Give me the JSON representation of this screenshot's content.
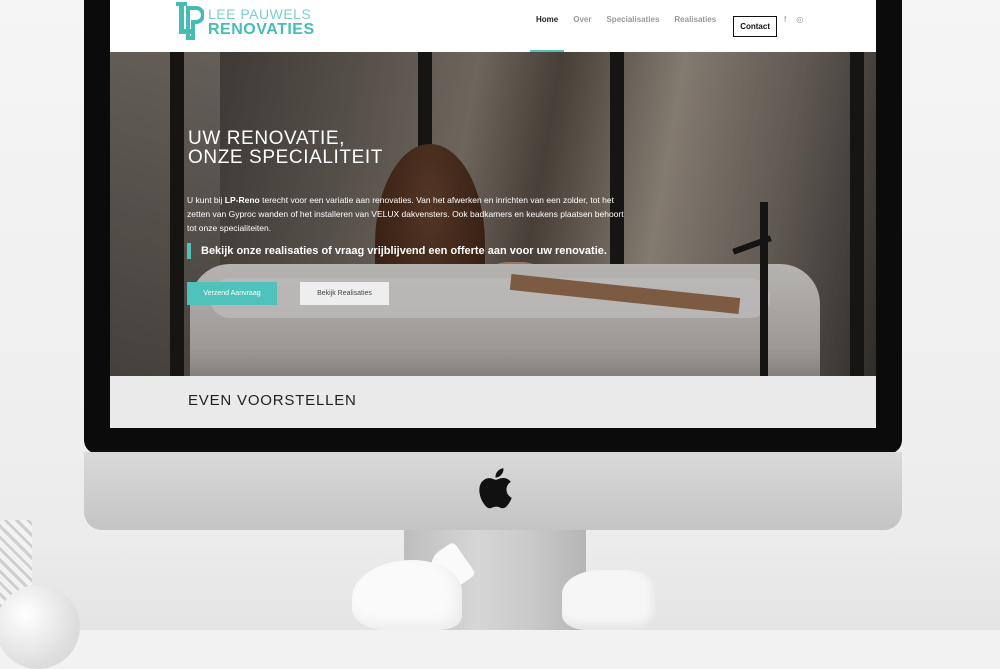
{
  "brand": {
    "logo_mark": "LP",
    "line1": "LEE PAUWELS",
    "line2": "RENOVATIES",
    "accent_color": "#4fc3bb"
  },
  "nav": {
    "items": [
      {
        "label": "Home",
        "active": true
      },
      {
        "label": "Over",
        "active": false
      },
      {
        "label": "Specialisaties",
        "active": false
      },
      {
        "label": "Realisaties",
        "active": false
      }
    ],
    "contact_label": "Contact",
    "social": [
      {
        "icon": "facebook-icon",
        "glyph": "f"
      },
      {
        "icon": "instagram-icon",
        "glyph": "◎"
      }
    ]
  },
  "hero": {
    "title_line1": "UW RENOVATIE,",
    "title_line2": "ONZE SPECIALITEIT",
    "text_before": "U kunt bij ",
    "text_bold": "LP-Reno",
    "text_after": " terecht voor een variatie aan renovaties. Van het afwerken en inrichten van een zolder, tot het zetten van Gyproc wanden of het installeren van VELUX dakvensters. Ook badkamers en keukens plaatsen behoort tot onze specialiteiten.",
    "quote": "Bekijk onze realisaties of vraag vrijblijvend een offerte aan voor uw renovatie.",
    "btn_primary": "Verzend Aanvraag",
    "btn_secondary": "Bekijk Realisaties"
  },
  "section": {
    "title": "EVEN VOORSTELLEN"
  }
}
